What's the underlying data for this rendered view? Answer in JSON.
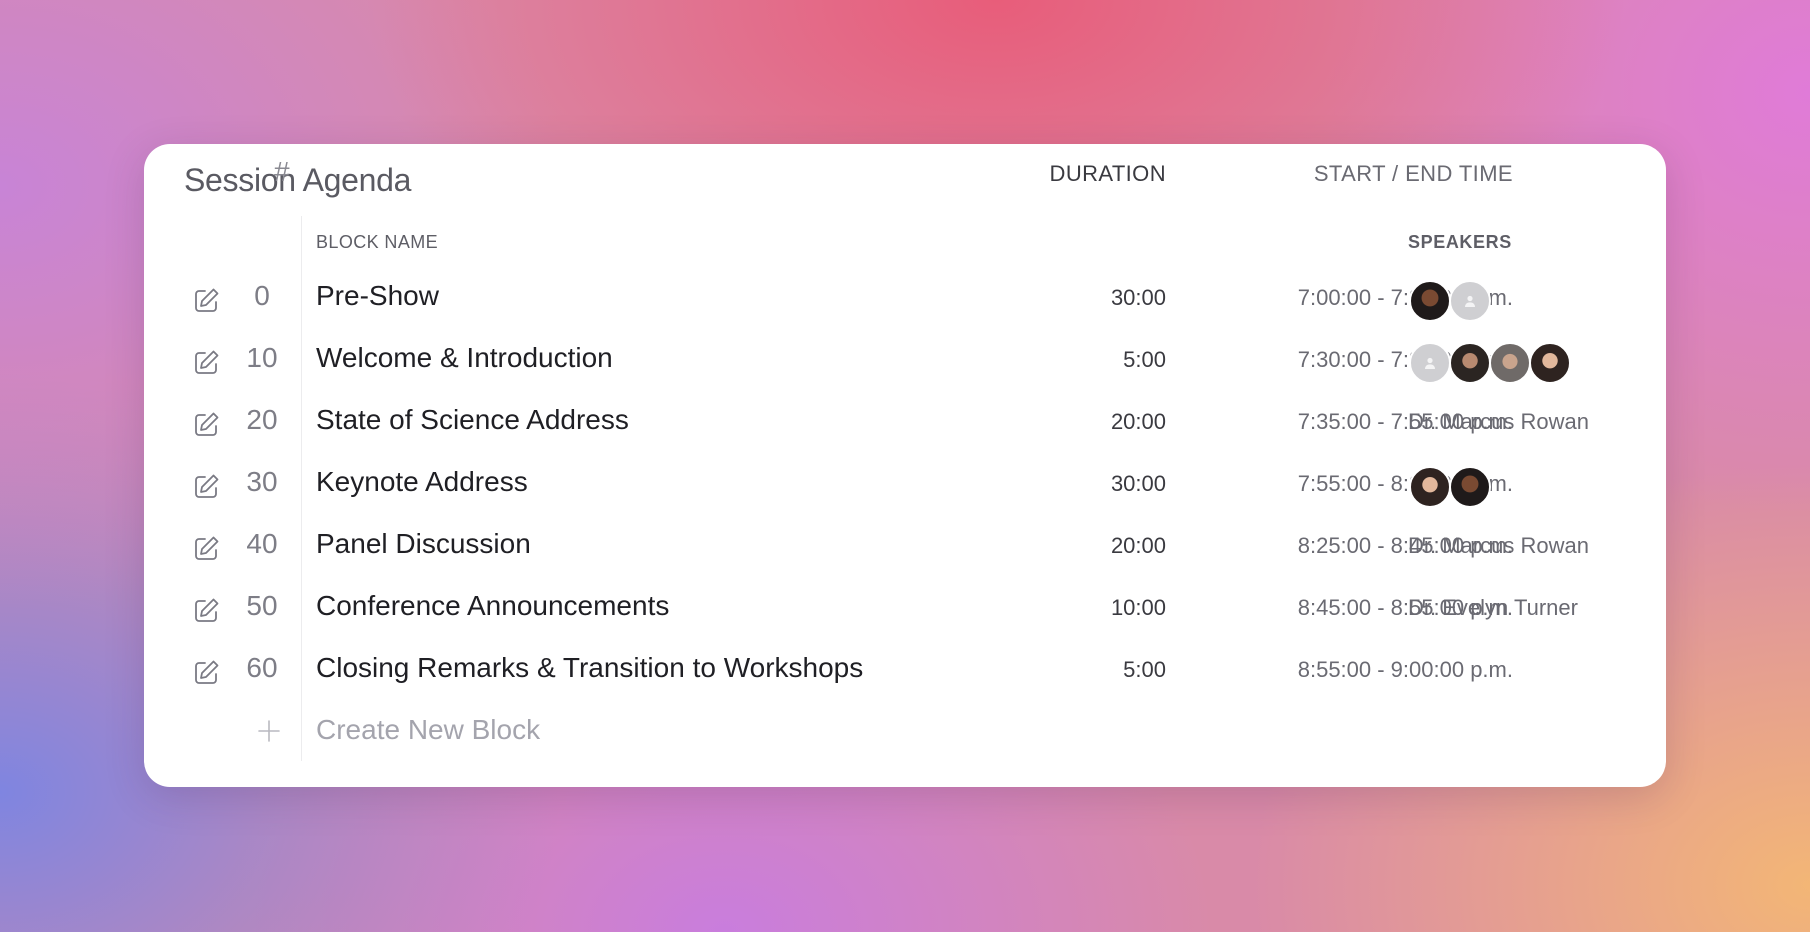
{
  "title": "Session Agenda",
  "columns": {
    "num": "#",
    "name": "BLOCK NAME",
    "duration": "DURATION",
    "time": "START / END TIME",
    "speakers": "SPEAKERS"
  },
  "rows": [
    {
      "num": "0",
      "name": "Pre-Show",
      "duration": "30:00",
      "time": "7:00:00 - 7:30:00 p.m.",
      "speaker_text": "",
      "avatars": [
        "p1",
        "ph"
      ]
    },
    {
      "num": "10",
      "name": "Welcome & Introduction",
      "duration": "5:00",
      "time": "7:30:00 - 7:35:00 p.m.",
      "speaker_text": "",
      "avatars": [
        "ph",
        "p2",
        "p3",
        "p4"
      ]
    },
    {
      "num": "20",
      "name": "State of Science Address",
      "duration": "20:00",
      "time": "7:35:00 - 7:55:00 p.m.",
      "speaker_text": "Dr. Marcus Rowan",
      "avatars": []
    },
    {
      "num": "30",
      "name": "Keynote Address",
      "duration": "30:00",
      "time": "7:55:00 - 8:25:00 p.m.",
      "speaker_text": "",
      "avatars": [
        "p4",
        "p1"
      ]
    },
    {
      "num": "40",
      "name": "Panel Discussion",
      "duration": "20:00",
      "time": "8:25:00 - 8:45:00 p.m.",
      "speaker_text": "Dr. Marcus Rowan",
      "avatars": []
    },
    {
      "num": "50",
      "name": "Conference Announcements",
      "duration": "10:00",
      "time": "8:45:00 - 8:55:00 p.m.",
      "speaker_text": "Dr. Evelyn Turner",
      "avatars": []
    },
    {
      "num": "60",
      "name": "Closing Remarks & Transition to Workshops",
      "duration": "5:00",
      "time": "8:55:00 - 9:00:00 p.m.",
      "speaker_text": "",
      "avatars": []
    }
  ],
  "create_label": "Create New Block",
  "icons": {
    "edit": "pencil-square-icon",
    "add": "plus-icon",
    "avatar_placeholder": "person-icon"
  }
}
